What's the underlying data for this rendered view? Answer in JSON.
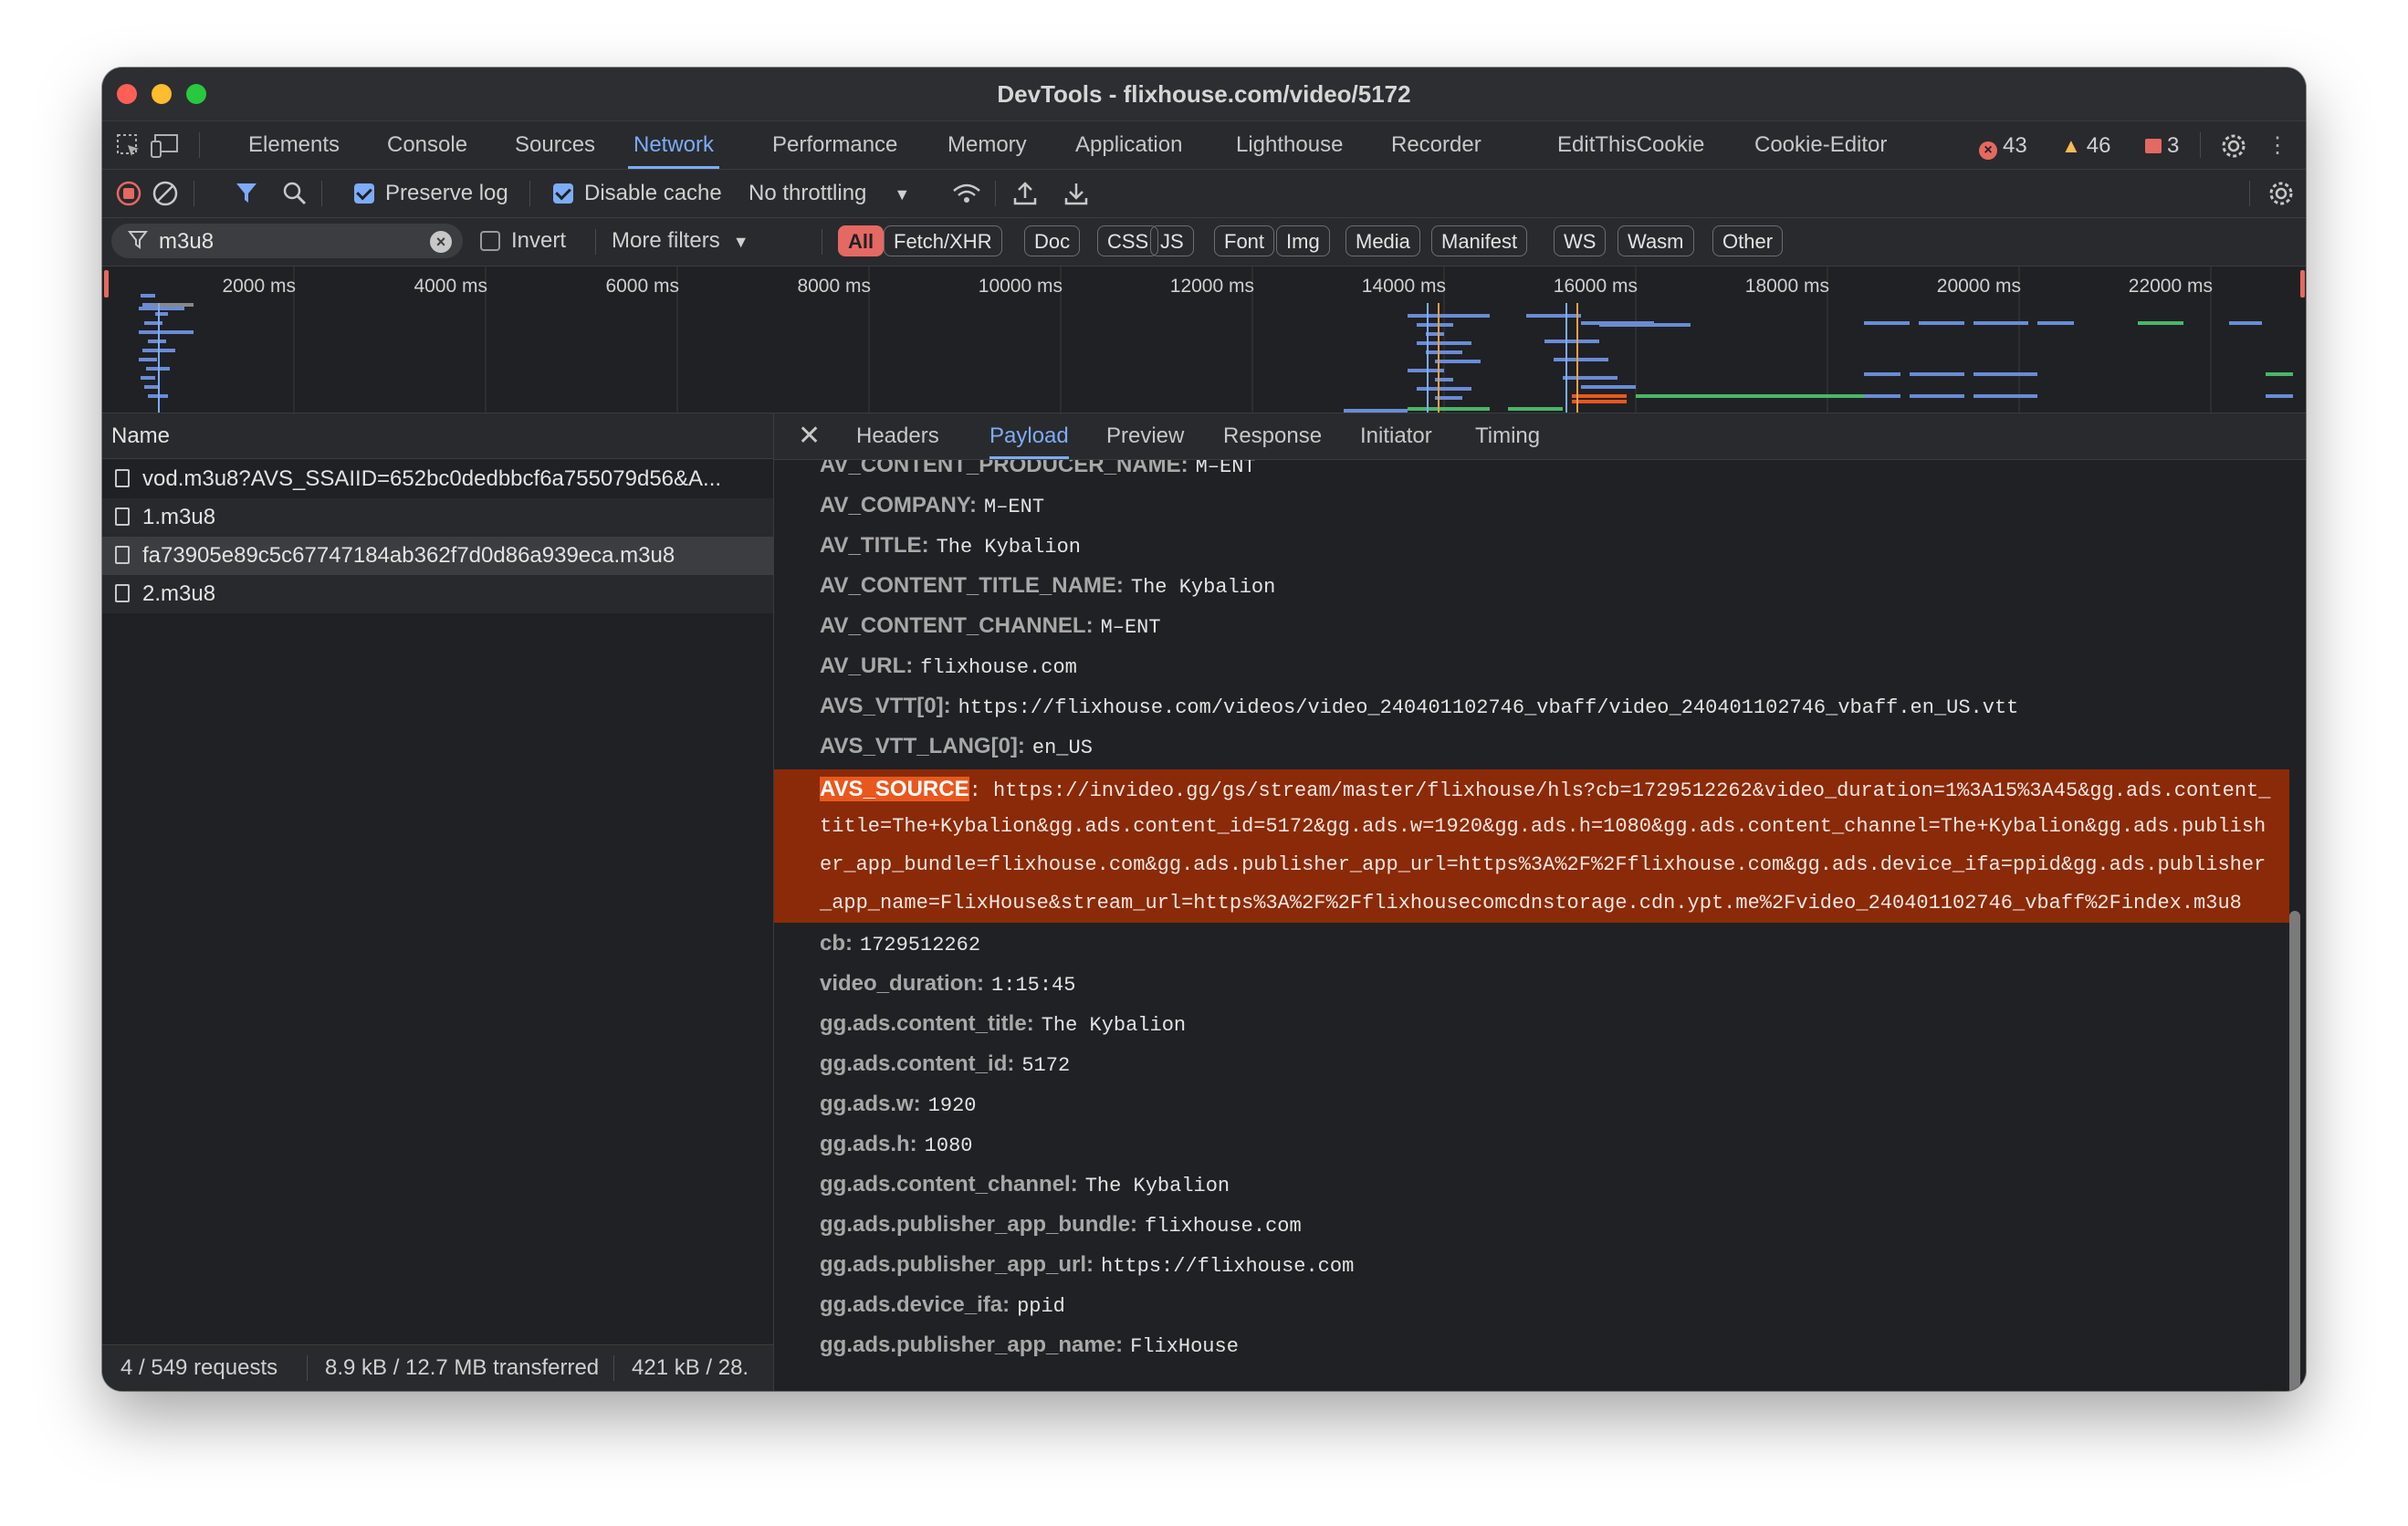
{
  "window": {
    "title": "DevTools - flixhouse.com/video/5172"
  },
  "main_tabs": [
    {
      "label": "Elements"
    },
    {
      "label": "Console"
    },
    {
      "label": "Sources"
    },
    {
      "label": "Network"
    },
    {
      "label": "Performance"
    },
    {
      "label": "Memory"
    },
    {
      "label": "Application"
    },
    {
      "label": "Lighthouse"
    },
    {
      "label": "Recorder"
    },
    {
      "label": "EditThisCookie"
    },
    {
      "label": "Cookie-Editor"
    }
  ],
  "active_main_tab": "Network",
  "counters": {
    "errors": "43",
    "warnings": "46",
    "issues": "3"
  },
  "toolbar": {
    "preserve_log": "Preserve log",
    "preserve_log_checked": true,
    "disable_cache": "Disable cache",
    "disable_cache_checked": true,
    "throttling": "No throttling"
  },
  "filter": {
    "value": "m3u8",
    "invert_label": "Invert",
    "more_filters": "More filters",
    "types": [
      "All",
      "Fetch/XHR",
      "Doc",
      "CSS",
      "JS",
      "Font",
      "Img",
      "Media",
      "Manifest",
      "WS",
      "Wasm",
      "Other"
    ],
    "active_type": "All"
  },
  "timeline": {
    "ticks": [
      "2000 ms",
      "4000 ms",
      "6000 ms",
      "8000 ms",
      "10000 ms",
      "12000 ms",
      "14000 ms",
      "16000 ms",
      "18000 ms",
      "20000 ms",
      "22000 ms"
    ]
  },
  "requests": {
    "header": "Name",
    "rows": [
      {
        "name": "vod.m3u8?AVS_SSAIID=652bc0dedbbcf6a755079d56&A..."
      },
      {
        "name": "1.m3u8"
      },
      {
        "name": "fa73905e89c5c67747184ab362f7d0d86a939eca.m3u8"
      },
      {
        "name": "2.m3u8"
      }
    ],
    "selected_index": 2
  },
  "status": {
    "requests": "4 / 549 requests",
    "transferred": "8.9 kB / 12.7 MB transferred",
    "resources": "421 kB / 28."
  },
  "detail_tabs": [
    {
      "label": "Headers"
    },
    {
      "label": "Payload"
    },
    {
      "label": "Preview"
    },
    {
      "label": "Response"
    },
    {
      "label": "Initiator"
    },
    {
      "label": "Timing"
    }
  ],
  "active_detail_tab": "Payload",
  "payload_before": [
    {
      "key": "AV_CONTENT_PRODUCER_NAME:",
      "value": "M–ENT"
    },
    {
      "key": "AV_COMPANY:",
      "value": "M–ENT"
    },
    {
      "key": "AV_TITLE:",
      "value": "The Kybalion"
    },
    {
      "key": "AV_CONTENT_TITLE_NAME:",
      "value": "The Kybalion"
    },
    {
      "key": "AV_CONTENT_CHANNEL:",
      "value": "M–ENT"
    },
    {
      "key": "AV_URL:",
      "value": "flixhouse.com"
    },
    {
      "key": "AVS_VTT[0]:",
      "value": "https://flixhouse.com/videos/video_240401102746_vbaff/video_240401102746_vbaff.en_US.vtt"
    },
    {
      "key": "AVS_VTT_LANG[0]:",
      "value": "en_US"
    }
  ],
  "highlighted": {
    "key": "AVS_SOURCE",
    "lines": [
      ": https://invideo.gg/gs/stream/master/flixhouse/hls?cb=1729512262&video_duration=1%3A15%3A45&gg.ads.content_",
      "title=The+Kybalion&gg.ads.content_id=5172&gg.ads.w=1920&gg.ads.h=1080&gg.ads.content_channel=The+Kybalion&gg.ads.publish",
      "er_app_bundle=flixhouse.com&gg.ads.publisher_app_url=https%3A%2F%2Fflixhouse.com&gg.ads.device_ifa=ppid&gg.ads.publisher",
      "_app_name=FlixHouse&stream_url=https%3A%2F%2Fflixhousecomcdnstorage.cdn.ypt.me%2Fvideo_240401102746_vbaff%2Findex.m3u8"
    ]
  },
  "payload_after": [
    {
      "key": "cb:",
      "value": "1729512262"
    },
    {
      "key": "video_duration:",
      "value": "1:15:45"
    },
    {
      "key": "gg.ads.content_title:",
      "value": "The Kybalion"
    },
    {
      "key": "gg.ads.content_id:",
      "value": "5172"
    },
    {
      "key": "gg.ads.w:",
      "value": "1920"
    },
    {
      "key": "gg.ads.h:",
      "value": "1080"
    },
    {
      "key": "gg.ads.content_channel:",
      "value": "The Kybalion"
    },
    {
      "key": "gg.ads.publisher_app_bundle:",
      "value": "flixhouse.com"
    },
    {
      "key": "gg.ads.publisher_app_url:",
      "value": "https://flixhouse.com"
    },
    {
      "key": "gg.ads.device_ifa:",
      "value": "ppid"
    },
    {
      "key": "gg.ads.publisher_app_name:",
      "value": "FlixHouse"
    }
  ],
  "colors": {
    "accent": "#7cacf8",
    "highlight_bg": "#8a2a08",
    "highlight_key": "#e8581e",
    "error": "#e46962",
    "warning": "#f7bb54"
  }
}
